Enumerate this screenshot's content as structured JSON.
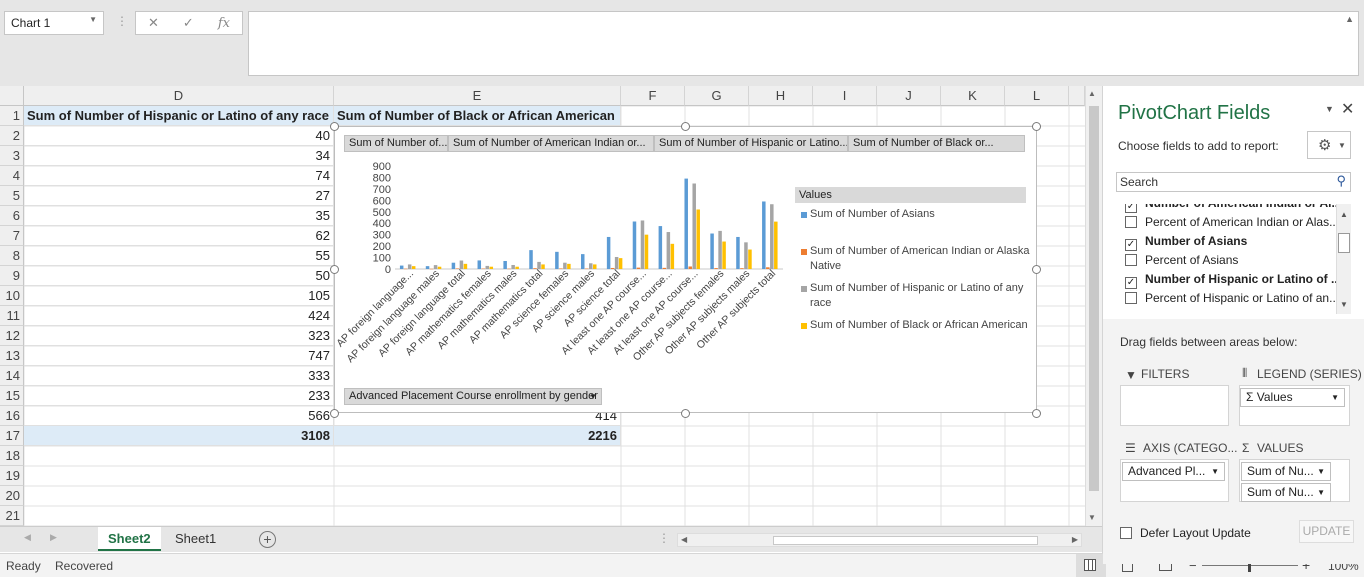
{
  "namebox": {
    "value": "Chart 1"
  },
  "formula": {
    "value": ""
  },
  "columns": [
    {
      "letter": "D"
    },
    {
      "letter": "E"
    },
    {
      "letter": "F"
    },
    {
      "letter": "G"
    },
    {
      "letter": "H"
    },
    {
      "letter": "I"
    },
    {
      "letter": "J"
    },
    {
      "letter": "K"
    },
    {
      "letter": "L"
    }
  ],
  "rows": [
    "1",
    "2",
    "3",
    "4",
    "5",
    "6",
    "7",
    "8",
    "9",
    "10",
    "11",
    "12",
    "13",
    "14",
    "15",
    "16",
    "17",
    "18",
    "19",
    "20",
    "21"
  ],
  "headers": {
    "d": "Sum of Number of Hispanic or Latino of any race",
    "e": "Sum of Number of Black or African American"
  },
  "d_values": [
    "40",
    "34",
    "74",
    "27",
    "35",
    "62",
    "55",
    "50",
    "105",
    "424",
    "323",
    "747",
    "333",
    "233",
    "566"
  ],
  "e_visible": {
    "row16": "414"
  },
  "totals": {
    "d": "3108",
    "e": "2216"
  },
  "chart": {
    "field_buttons": [
      "Sum of Number of...",
      "Sum of Number of American Indian or...",
      "Sum of Number of Hispanic or Latino...",
      "Sum of Number of Black or..."
    ],
    "axis_button": "Advanced Placement Course enrollment by gender",
    "legend_title": "Values",
    "colors": {
      "asian": "#5b9bd5",
      "native": "#ed7d31",
      "hispanic": "#a5a5a5",
      "black": "#ffc000"
    }
  },
  "chart_data": {
    "type": "bar",
    "ylim": [
      0,
      900
    ],
    "yticks": [
      "0",
      "100",
      "200",
      "300",
      "400",
      "500",
      "600",
      "700",
      "800",
      "900"
    ],
    "categories": [
      "AP foreign language...",
      "AP foreign language males",
      "AP foreign language total",
      "AP mathematics females",
      "AP mathematics males",
      "AP mathematics total",
      "AP science females",
      "AP science males",
      "AP science total",
      "At least one AP course...",
      "At least one AP course...",
      "At least one AP course...",
      "Other AP subjects females",
      "Other AP subjects males",
      "Other AP subjects total"
    ],
    "series": [
      {
        "name": "Sum of Number of Asians",
        "values": [
          30,
          25,
          55,
          75,
          70,
          165,
          150,
          130,
          280,
          415,
          375,
          790,
          310,
          280,
          590
        ]
      },
      {
        "name": "Sum of Number of American Indian or Alaska Native",
        "values": [
          3,
          2,
          5,
          4,
          3,
          7,
          5,
          4,
          9,
          12,
          10,
          22,
          8,
          7,
          15
        ]
      },
      {
        "name": "Sum of Number of Hispanic or Latino of any race",
        "values": [
          40,
          34,
          74,
          27,
          35,
          62,
          55,
          50,
          105,
          424,
          323,
          747,
          333,
          233,
          566
        ]
      },
      {
        "name": "Sum of Number of Black or African American",
        "values": [
          25,
          20,
          45,
          20,
          20,
          40,
          45,
          40,
          95,
          300,
          220,
          520,
          240,
          170,
          414
        ]
      }
    ],
    "legend_position": "right"
  },
  "legend_labels": [
    "Sum of Number of Asians",
    "Sum of Number of American Indian or Alaska Native",
    "Sum of Number of Hispanic or Latino of any race",
    "Sum of Number of Black or African American"
  ],
  "sheets": {
    "active": "Sheet2",
    "other": "Sheet1"
  },
  "status": {
    "ready": "Ready",
    "recovered": "Recovered",
    "zoom": "100%"
  },
  "panel": {
    "title": "PivotChart Fields",
    "choose": "Choose fields to add to report:",
    "search_placeholder": "Search",
    "fields": [
      {
        "label": "Number of American Indian or Al...",
        "checked": true,
        "bold": true
      },
      {
        "label": "Percent of American Indian or Alas...",
        "checked": false,
        "bold": false
      },
      {
        "label": "Number of Asians",
        "checked": true,
        "bold": true
      },
      {
        "label": "Percent of Asians",
        "checked": false,
        "bold": false
      },
      {
        "label": "Number of Hispanic or Latino of ...",
        "checked": true,
        "bold": true
      },
      {
        "label": "Percent of Hispanic or Latino of an...",
        "checked": false,
        "bold": false
      }
    ],
    "drag_text": "Drag fields between areas below:",
    "filters": "FILTERS",
    "legend": "LEGEND (SERIES)",
    "legend_item": "Values",
    "axis": "AXIS (CATEGO...",
    "axis_item": "Advanced Pl...",
    "values": "VALUES",
    "values_items": [
      "Sum of Nu...",
      "Sum of Nu..."
    ],
    "defer": "Defer Layout Update",
    "update": "UPDATE"
  }
}
